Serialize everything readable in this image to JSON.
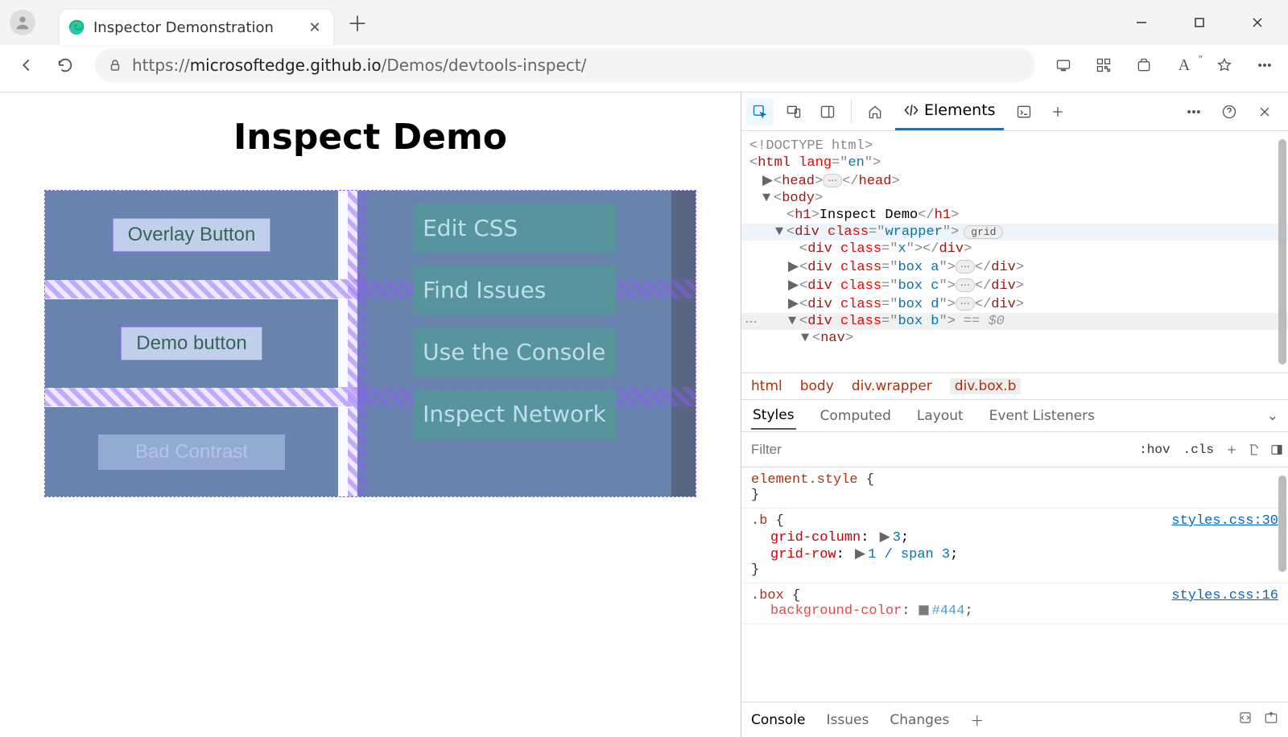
{
  "browser": {
    "tab_title": "Inspector Demonstration",
    "url_prefix": "https://",
    "url_domain": "microsoftedge.github.io",
    "url_path": "/Demos/devtools-inspect/",
    "read_aloud": "A"
  },
  "page": {
    "heading": "Inspect Demo",
    "overlay_button": "Overlay Button",
    "demo_button": "Demo button",
    "bad_contrast": "Bad Contrast",
    "nav": [
      "Edit CSS",
      "Find Issues",
      "Use the Console",
      "Inspect Network"
    ]
  },
  "devtools": {
    "main_tabs": {
      "elements": "Elements"
    },
    "dom": {
      "doctype": "<!DOCTYPE html>",
      "html_open": "html",
      "html_lang_attr": "lang",
      "html_lang_val": "en",
      "head": "head",
      "body": "body",
      "h1": "h1",
      "h1_text": "Inspect Demo",
      "div": "div",
      "class_attr": "class",
      "wrapper_val": "wrapper",
      "grid_badge": "grid",
      "x_val": "x",
      "box_a": "box a",
      "box_c": "box c",
      "box_d": "box d",
      "box_b": "box b",
      "nav": "nav",
      "eq": "== $0"
    },
    "breadcrumb": [
      "html",
      "body",
      "div.wrapper",
      "div.box.b"
    ],
    "styles_tabs": [
      "Styles",
      "Computed",
      "Layout",
      "Event Listeners"
    ],
    "filter_placeholder": "Filter",
    "hov": ":hov",
    "cls": ".cls",
    "rules": {
      "element_style": "element.style",
      "b_sel": ".b",
      "b_link": "styles.css:30",
      "grid_column": "grid-column",
      "grid_column_val": "3",
      "grid_row": "grid-row",
      "grid_row_val": "1 / span 3",
      "box_sel": ".box",
      "box_link": "styles.css:16",
      "bg": "background-color",
      "bg_val": "#444"
    },
    "drawer": [
      "Console",
      "Issues",
      "Changes"
    ]
  }
}
